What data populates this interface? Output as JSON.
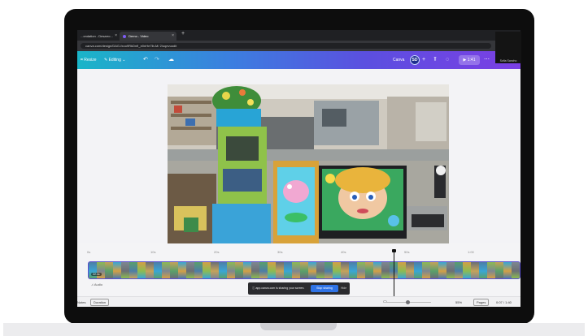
{
  "browser": {
    "tabs": [
      {
        "label": "...ondation - Desarro...",
        "close": "×"
      },
      {
        "label": "Demo - Video",
        "close": "×"
      }
    ],
    "new_tab": "+",
    "url": "canva.com/design/DAG-fxoo9RkDnfI_e0nHe7lb-M/ 2/uqevuodit"
  },
  "toolbar": {
    "resize": "⌗ Resize",
    "editing": "✎ Editing ⌄",
    "undo": "↶",
    "redo": "↷",
    "cloud": "☁",
    "doc_title": "Canva",
    "avatar": "SD",
    "add": "+",
    "analytics": "⫪",
    "comments": "◌",
    "play": "▶ 1:41",
    "more": "⋯"
  },
  "timeline": {
    "ticks": [
      "0s",
      "10s",
      "20s",
      "30s",
      "40s",
      "50s",
      "1:00"
    ],
    "audio_label": "♫ Audio",
    "clip_badge": "22.1s"
  },
  "share_banner": {
    "message": "ⓘ app.canva.com is sharing your screen.",
    "stop_label": "Stop sharing",
    "hide_label": "Hide"
  },
  "status": {
    "notes": "Notes",
    "duration": "Duration",
    "zoom": "55%",
    "pages": "Pages",
    "time": "0:07 / 1:40"
  },
  "webcam": {
    "name": "Sofia Sancho"
  },
  "colors": {
    "toolbar_start": "#1ab5c8",
    "toolbar_end": "#7b3fe4",
    "clip_border": "#5a4fcf",
    "stop_sharing": "#2f73e6"
  }
}
